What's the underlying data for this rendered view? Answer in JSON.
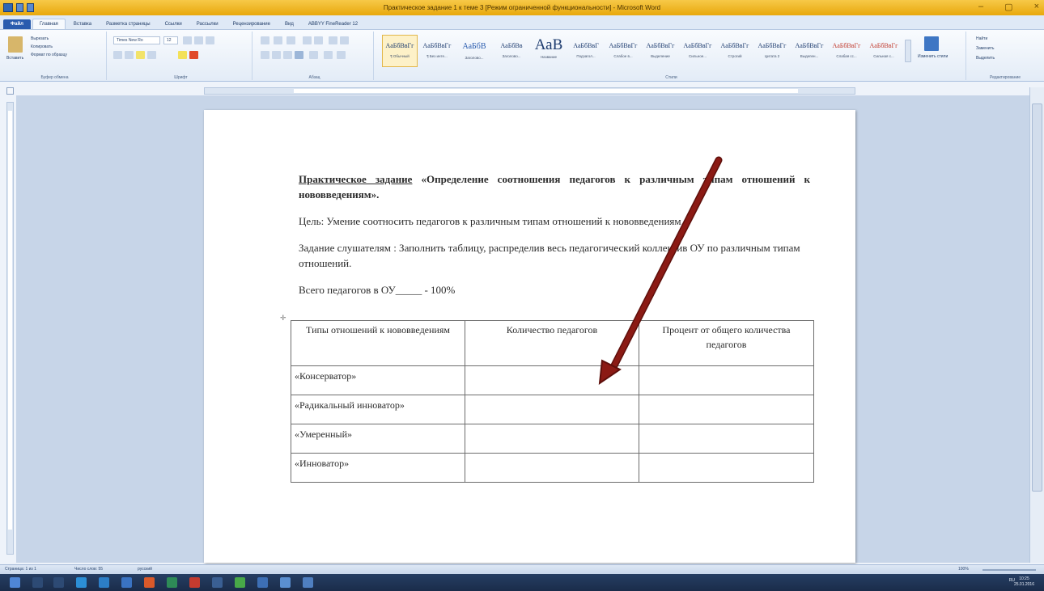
{
  "window": {
    "title": "Практическое задание 1 к теме 3 [Режим ограниченной функциональности] - Microsoft Word",
    "controls": [
      "–",
      "▢",
      "×"
    ]
  },
  "ribbon_tabs": [
    "Файл",
    "Главная",
    "Вставка",
    "Разметка страницы",
    "Ссылки",
    "Рассылки",
    "Рецензирование",
    "Вид",
    "ABBYY FineReader 12"
  ],
  "ribbon": {
    "clipboard": {
      "paste": "Вставить",
      "cut": "Вырезать",
      "copy": "Копировать",
      "format_painter": "Формат по образцу",
      "label": "Буфер обмена"
    },
    "font": {
      "family": "Times New Ro",
      "size": "12",
      "label": "Шрифт"
    },
    "paragraph": {
      "label": "Абзац"
    },
    "styles": {
      "label": "Стили",
      "items": [
        {
          "sample": "АаБбВвГг",
          "name": "¶ Обычный"
        },
        {
          "sample": "АаБбВвГг",
          "name": "¶ Без инте..."
        },
        {
          "sample": "АаБбВ",
          "name": "Заголово..."
        },
        {
          "sample": "АаБбВв",
          "name": "Заголово..."
        },
        {
          "sample": "АаВ",
          "name": "Название"
        },
        {
          "sample": "АаБбВвГ",
          "name": "Подзагол..."
        },
        {
          "sample": "АаБбВвГг",
          "name": "Слабое в..."
        },
        {
          "sample": "АаБбВвГг",
          "name": "Выделение"
        },
        {
          "sample": "АаБбВвГг",
          "name": "Сильное..."
        },
        {
          "sample": "АаБбВвГг",
          "name": "Строгий"
        },
        {
          "sample": "АаБбВвГг",
          "name": "Цитата 2"
        },
        {
          "sample": "АаБбВвГг",
          "name": "Выделен..."
        },
        {
          "sample": "АаБбВвГг",
          "name": "Слабая сс..."
        },
        {
          "sample": "АаБбВвГг",
          "name": "Сильная с..."
        }
      ],
      "change_styles": "Изменить стили"
    },
    "editing": {
      "find": "Найти",
      "replace": "Заменить",
      "select": "Выделить",
      "label": "Редактирование"
    }
  },
  "document": {
    "title_underlined": "Практическое задание",
    "title_rest": " «Определение соотношения педагогов к различным типам отношений к нововведениям».",
    "goal": "Цель: Умение соотносить педагогов к различным типам отношений к нововведениям.",
    "task": "Задание слушателям : Заполнить таблицу, распределив весь педагогический коллектив ОУ по различным типам отношений.",
    "total": "Всего педагогов в ОУ_____ - 100%",
    "table": {
      "headers": [
        "Типы отношений к нововведениям",
        "Количество педагогов",
        "Процент от общего количества педагогов"
      ],
      "rows": [
        [
          "«Консерватор»",
          "",
          ""
        ],
        [
          "«Радикальный инноватор»",
          "",
          ""
        ],
        [
          "«Умеренный»",
          "",
          ""
        ],
        [
          "«Инноватор»",
          "",
          ""
        ]
      ]
    }
  },
  "statusbar": {
    "page": "Страница: 1 из 1",
    "words": "Число слов: 55",
    "language": "русский",
    "zoom": "100%"
  },
  "taskbar": {
    "tray_lang": "RU",
    "time": "10:25",
    "date": "25.01.2016"
  },
  "colors": {
    "title_bar": "#e8a80c",
    "file_tab": "#2a5cae",
    "arrow": "#8b1a14"
  }
}
